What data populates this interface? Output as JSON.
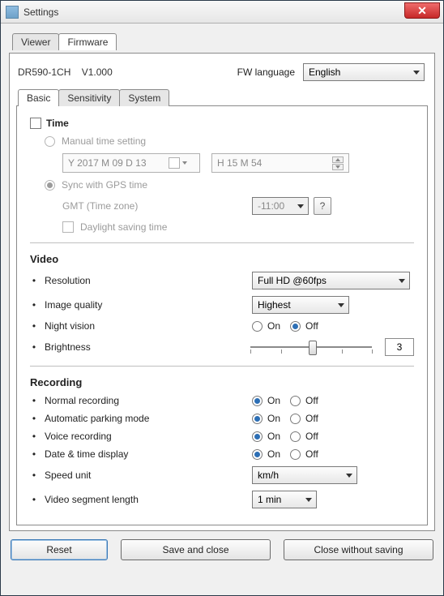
{
  "window": {
    "title": "Settings"
  },
  "top_tabs": {
    "viewer": "Viewer",
    "firmware": "Firmware",
    "active": "firmware"
  },
  "fw_info": {
    "model": "DR590-1CH",
    "version": "V1.000",
    "lang_label": "FW language",
    "lang_value": "English"
  },
  "sub_tabs": {
    "basic": "Basic",
    "sensitivity": "Sensitivity",
    "system": "System",
    "active": "basic"
  },
  "time": {
    "section": "Time",
    "manual_label": "Manual time setting",
    "date_value": "Y 2017 M 09 D 13",
    "time_value": "H 15 M 54",
    "sync_label": "Sync with GPS time",
    "sync_selected": true,
    "gmt_label": "GMT (Time zone)",
    "gmt_value": "-11:00",
    "gmt_help": "?",
    "dst_label": "Daylight saving time"
  },
  "video": {
    "section": "Video",
    "resolution_label": "Resolution",
    "resolution_value": "Full HD @60fps",
    "image_quality_label": "Image quality",
    "image_quality_value": "Highest",
    "night_vision_label": "Night vision",
    "night_vision_value": "Off",
    "on": "On",
    "off": "Off",
    "brightness_label": "Brightness",
    "brightness_value": "3"
  },
  "recording": {
    "section": "Recording",
    "normal_label": "Normal recording",
    "normal_value": "On",
    "parking_label": "Automatic parking mode",
    "parking_value": "On",
    "voice_label": "Voice recording",
    "voice_value": "On",
    "datetime_label": "Date & time display",
    "datetime_value": "On",
    "on": "On",
    "off": "Off",
    "speed_label": "Speed unit",
    "speed_value": "km/h",
    "segment_label": "Video segment length",
    "segment_value": "1 min"
  },
  "footer": {
    "reset": "Reset",
    "save": "Save and close",
    "close": "Close without saving"
  },
  "chart_data": null
}
